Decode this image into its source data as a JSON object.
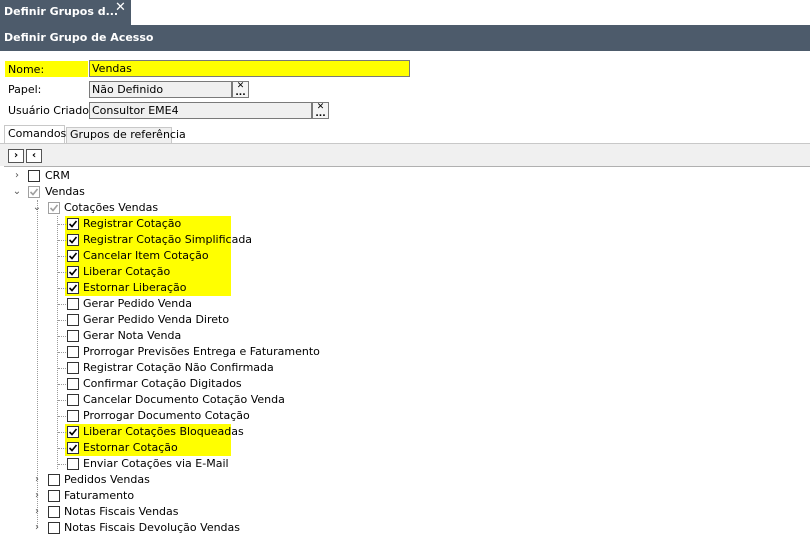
{
  "tab": {
    "title": "Definir Grupos d...",
    "close_glyph": "✕"
  },
  "header": {
    "title": "Definir Grupo de Acesso"
  },
  "form": {
    "nome_label": "Nome:",
    "nome_value": "Vendas",
    "papel_label": "Papel:",
    "papel_value": "Não Definido",
    "usuario_label": "Usuário Criador:",
    "usuario_value": "Consultor EME4",
    "picker_clear": "✕",
    "picker_more": "..."
  },
  "tabs": [
    "Comandos",
    "Grupos de referência"
  ],
  "toolbar": {
    "expand_glyph": "›",
    "collapse_glyph": "‹"
  },
  "colors": {
    "header": "#4d5b6b",
    "highlight": "#ffff00"
  },
  "tree": [
    {
      "label": "CRM",
      "level": 0,
      "expander": "›",
      "checked": false
    },
    {
      "label": "Vendas",
      "level": 0,
      "expander": "⌄",
      "checked": "partial"
    },
    {
      "label": "Cotações Vendas",
      "level": 1,
      "expander": "⌄",
      "checked": "partial"
    },
    {
      "label": "Registrar Cotação",
      "level": 2,
      "checked": true,
      "highlight": true
    },
    {
      "label": "Registrar Cotação Simplificada",
      "level": 2,
      "checked": true,
      "highlight": true
    },
    {
      "label": "Cancelar Item Cotação",
      "level": 2,
      "checked": true,
      "highlight": true
    },
    {
      "label": "Liberar Cotação",
      "level": 2,
      "checked": true,
      "highlight": true
    },
    {
      "label": "Estornar Liberação",
      "level": 2,
      "checked": true,
      "highlight": true
    },
    {
      "label": "Gerar Pedido Venda",
      "level": 2,
      "checked": false
    },
    {
      "label": "Gerar Pedido Venda Direto",
      "level": 2,
      "checked": false
    },
    {
      "label": "Gerar Nota Venda",
      "level": 2,
      "checked": false
    },
    {
      "label": "Prorrogar Previsões Entrega e Faturamento",
      "level": 2,
      "checked": false
    },
    {
      "label": "Registrar Cotação Não Confirmada",
      "level": 2,
      "checked": false
    },
    {
      "label": "Confirmar Cotação Digitados",
      "level": 2,
      "checked": false
    },
    {
      "label": "Cancelar Documento Cotação Venda",
      "level": 2,
      "checked": false
    },
    {
      "label": "Prorrogar Documento Cotação",
      "level": 2,
      "checked": false
    },
    {
      "label": "Liberar Cotações Bloqueadas",
      "level": 2,
      "checked": true,
      "highlight": true
    },
    {
      "label": "Estornar Cotação",
      "level": 2,
      "checked": true,
      "highlight": true
    },
    {
      "label": "Enviar Cotações via E-Mail",
      "level": 2,
      "checked": false
    },
    {
      "label": "Pedidos Vendas",
      "level": 1,
      "expander": "›",
      "checked": false
    },
    {
      "label": "Faturamento",
      "level": 1,
      "expander": "›",
      "checked": false
    },
    {
      "label": "Notas Fiscais Vendas",
      "level": 1,
      "expander": "›",
      "checked": false
    },
    {
      "label": "Notas Fiscais Devolução Vendas",
      "level": 1,
      "expander": "›",
      "checked": false
    }
  ]
}
